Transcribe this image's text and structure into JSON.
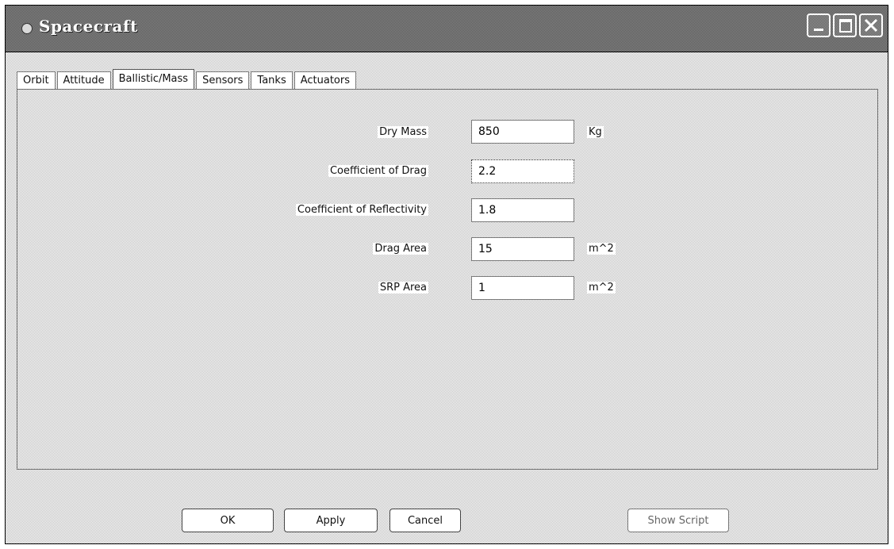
{
  "window": {
    "title": "Spacecraft"
  },
  "tabs": [
    {
      "label": "Orbit",
      "active": false
    },
    {
      "label": "Attitude",
      "active": false
    },
    {
      "label": "Ballistic/Mass",
      "active": true
    },
    {
      "label": "Sensors",
      "active": false
    },
    {
      "label": "Tanks",
      "active": false
    },
    {
      "label": "Actuators",
      "active": false
    }
  ],
  "form": {
    "dry_mass": {
      "label": "Dry Mass",
      "value": "850",
      "unit": "Kg"
    },
    "coefficient_of_drag": {
      "label": "Coefficient of Drag",
      "value": "2.2"
    },
    "coefficient_of_reflectivity": {
      "label": "Coefficient of Reflectivity",
      "value": "1.8"
    },
    "drag_area": {
      "label": "Drag Area",
      "value": "15",
      "unit": "m^2"
    },
    "srp_area": {
      "label": "SRP Area",
      "value": "1",
      "unit": "m^2"
    }
  },
  "buttons": {
    "ok": "OK",
    "apply": "Apply",
    "cancel": "Cancel",
    "show_script": "Show Script"
  },
  "icons": {
    "window_icon": "app-icon",
    "minimize": "minimize-icon",
    "maximize": "maximize-icon",
    "close": "close-icon"
  }
}
